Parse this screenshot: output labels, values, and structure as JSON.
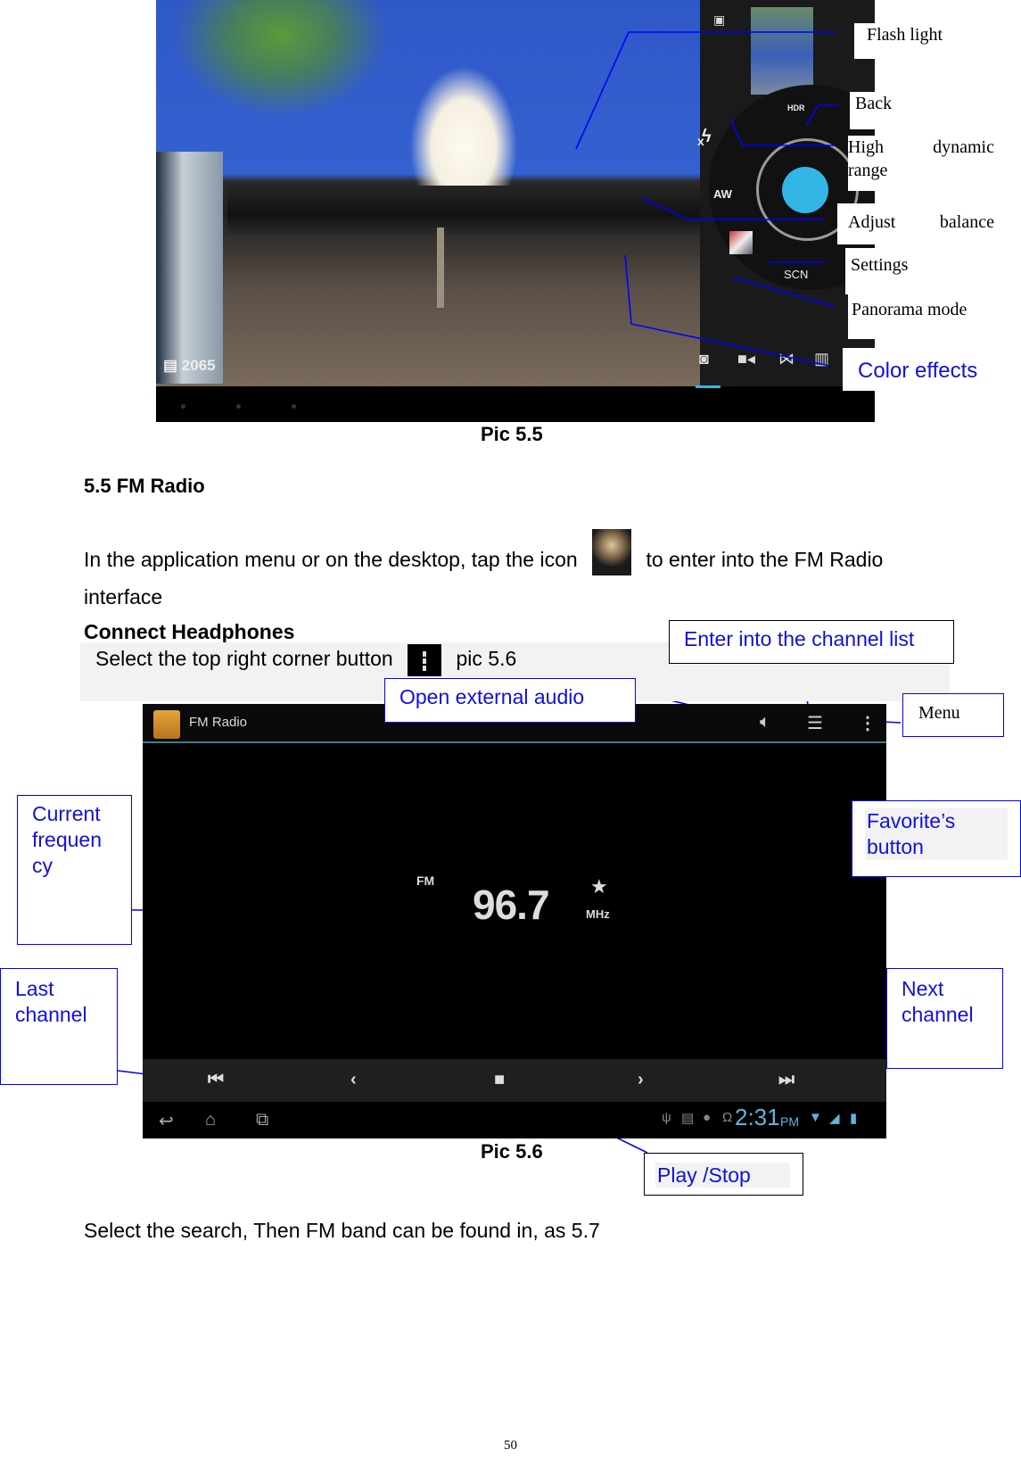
{
  "figure_5_5": {
    "caption": "Pic 5.5",
    "camera_ui": {
      "photo_counter": "2065",
      "mode_icons": [
        "camera-icon",
        "video-icon",
        "panorama-icon",
        "effects-icon"
      ],
      "dial_labels": {
        "hdr": "HDR",
        "white_balance": "AW",
        "scene": "SCN"
      },
      "shutter_color": "#33b5e5"
    },
    "callouts": {
      "flash_light": "Flash light",
      "back": "Back",
      "hdr_word1": "High",
      "hdr_word2": "dynamic",
      "hdr_word3": "range",
      "balance_word1": "Adjust",
      "balance_word2": "balance",
      "settings": "Settings",
      "panorama": "Panorama mode",
      "color_effects": "Color effects"
    }
  },
  "section": {
    "heading": "5.5 FM Radio",
    "intro_before_icon": "In the application menu or on the desktop, tap the icon",
    "intro_after_icon": "to enter into the FM Radio",
    "intro_line2": "interface",
    "subheading": "Connect Headphones",
    "instruction_before": "Select the top right corner button",
    "instruction_after": "pic 5.6"
  },
  "figure_5_6": {
    "caption": "Pic 5.6",
    "fm_ui": {
      "app_title": "FM Radio",
      "band": "FM",
      "frequency": "96.7",
      "unit": "MHz",
      "favorite_glyph": "★",
      "clock": "2:31",
      "ampm": "PM"
    },
    "callouts": {
      "channel_list": "Enter into the channel list",
      "external_audio": "Open external audio",
      "menu": "Menu",
      "current_freq_1": "Current",
      "current_freq_2": "frequen",
      "current_freq_3": "cy",
      "favorite_1": "Favorite’s",
      "favorite_2": "button",
      "last_1": "Last",
      "last_2": "channel",
      "next_1": "Next",
      "next_2": "channel",
      "play_stop": "Play /Stop"
    }
  },
  "footer": {
    "after_text": "Select the search, Then FM band can be found in, as 5.7",
    "page_number": "50"
  },
  "colors": {
    "callout_text": "#1010e0",
    "leader_line": "#0000ff",
    "accent": "#33b5e5"
  }
}
